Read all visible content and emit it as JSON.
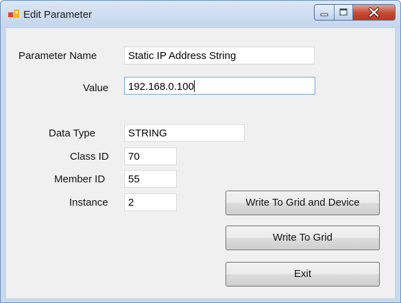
{
  "window": {
    "title": "Edit Parameter"
  },
  "icons": {
    "app": "app-icon",
    "minimize": "minimize-icon",
    "maximize": "maximize-icon",
    "close": "close-icon"
  },
  "colors": {
    "frame": "#c9d9ec",
    "client": "#f0f0f0",
    "close_button": "#c44a33",
    "focus_border": "#7aa7d8"
  },
  "form": {
    "parameter_name": {
      "label": "Parameter Name",
      "value": "Static IP Address String"
    },
    "value": {
      "label": "Value",
      "value": "192.168.0.100"
    },
    "data_type": {
      "label": "Data Type",
      "value": "STRING"
    },
    "class_id": {
      "label": "Class ID",
      "value": "70"
    },
    "member_id": {
      "label": "Member ID",
      "value": "55"
    },
    "instance": {
      "label": "Instance",
      "value": "2"
    }
  },
  "buttons": {
    "write_grid_device": "Write To Grid and Device",
    "write_grid": "Write To Grid",
    "exit": "Exit"
  }
}
